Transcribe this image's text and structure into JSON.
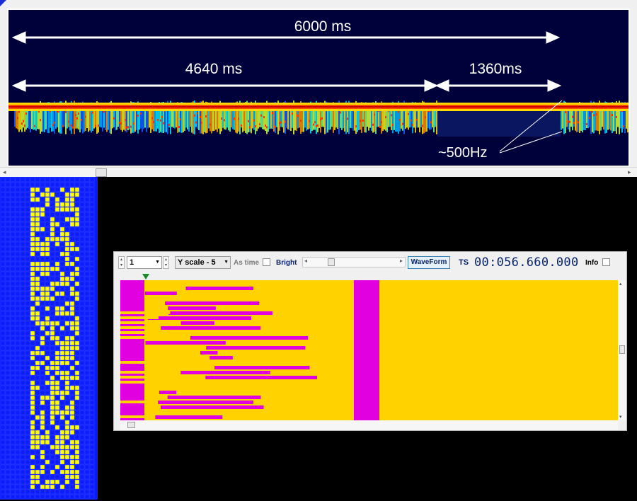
{
  "spectrogram": {
    "total_label": "6000 ms",
    "first_label": "4640 ms",
    "second_label": "1360ms",
    "freq_label": "~500Hz",
    "background_color": "#00003a"
  },
  "bit_pattern": {
    "grid_color": "#0b1cff",
    "bit_color": "#ffff00"
  },
  "waveform_window": {
    "channel_value": "1",
    "yscale_value": "Y scale - 5",
    "as_time_label": "As time",
    "bright_label": "Bright",
    "waveform_button": "WaveForm",
    "ts_label": "TS",
    "ts_value": "00:056.660.000",
    "info_label": "Info",
    "colors": {
      "high": "#ffd200",
      "low": "#e000e0"
    }
  }
}
